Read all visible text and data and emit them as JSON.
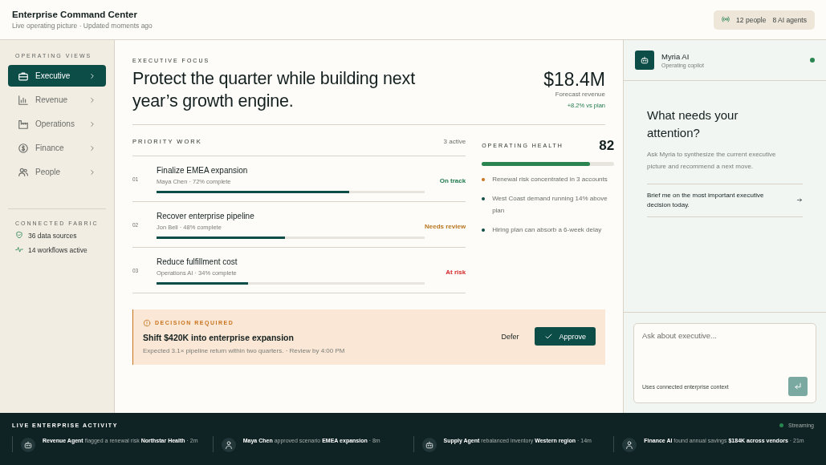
{
  "header": {
    "title": "Enterprise Command Center",
    "subtitle": "Live operating picture · Updated moments ago",
    "people": "12 people",
    "agents": "8 AI agents"
  },
  "sidebar": {
    "heading": "OPERATING VIEWS",
    "items": [
      {
        "label": "Executive",
        "selected": true
      },
      {
        "label": "Revenue",
        "selected": false
      },
      {
        "label": "Operations",
        "selected": false
      },
      {
        "label": "Finance",
        "selected": false
      },
      {
        "label": "People",
        "selected": false
      }
    ],
    "fabric_heading": "CONNECTED FABRIC",
    "fabric": [
      {
        "kind": "shield",
        "label": "36 data sources"
      },
      {
        "kind": "pulse",
        "label": "14 workflows active"
      }
    ]
  },
  "focus": {
    "eyebrow": "EXECUTIVE FOCUS",
    "headline": "Protect the quarter while building next year’s growth engine.",
    "metric": "$18.4M",
    "metric_label": "Forecast revenue",
    "metric_delta": "+8.2% vs plan"
  },
  "priority": {
    "heading": "PRIORITY WORK",
    "count": "3 active",
    "items": [
      {
        "number": "01",
        "title": "Finalize EMEA expansion",
        "meta": "Maya Chen · 72% complete",
        "level": 0.72,
        "status": "On track",
        "color": "#1f7a4d"
      },
      {
        "number": "02",
        "title": "Recover enterprise pipeline",
        "meta": "Jon Bell · 48% complete",
        "level": 0.48,
        "status": "Needs review",
        "color": "#b8751e"
      },
      {
        "number": "03",
        "title": "Reduce fulfillment cost",
        "meta": "Operations AI · 34% complete",
        "level": 0.34,
        "status": "At risk",
        "color": "#d42a2a"
      }
    ]
  },
  "health": {
    "heading": "OPERATING HEALTH",
    "score": "82",
    "level": 0.82,
    "notes": [
      {
        "text": "Renewal risk concentrated in 3 accounts",
        "color": "#c8741e"
      },
      {
        "text": "West Coast demand running 14% above plan",
        "color": "#0f4d46"
      },
      {
        "text": "Hiring plan can absorb a 6-week delay",
        "color": "#0f4d46"
      }
    ]
  },
  "decision": {
    "label": "DECISION REQUIRED",
    "title": "Shift $420K into enterprise expansion",
    "detail": "Expected 3.1× pipeline return within two quarters. · Review by 4:00 PM",
    "secondary": "Defer",
    "primary": "Approve"
  },
  "assistant": {
    "name": "Myria AI",
    "role": "Operating copilot",
    "online": true,
    "question": "What needs your attention?",
    "intro": "Ask Myria to synthesize the current executive picture and recommend a next move.",
    "suggestion": "Brief me on the most important executive decision today.",
    "placeholder": "Ask about executive...",
    "context": "Uses connected enterprise context"
  },
  "activity": {
    "heading": "LIVE ENTERPRISE ACTIVITY",
    "status": "Streaming",
    "items": [
      {
        "kind": "agent",
        "text": "**Revenue Agent** flagged a renewal risk **Northstar Health** · 2m"
      },
      {
        "kind": "person",
        "text": "**Maya Chen** approved scenario **EMEA expansion** · 8m"
      },
      {
        "kind": "agent",
        "text": "**Supply Agent** rebalanced inventory **Western region** · 14m"
      },
      {
        "kind": "person",
        "text": "**Finance AI** found annual savings **$184K across vendors** · 21m"
      }
    ]
  }
}
